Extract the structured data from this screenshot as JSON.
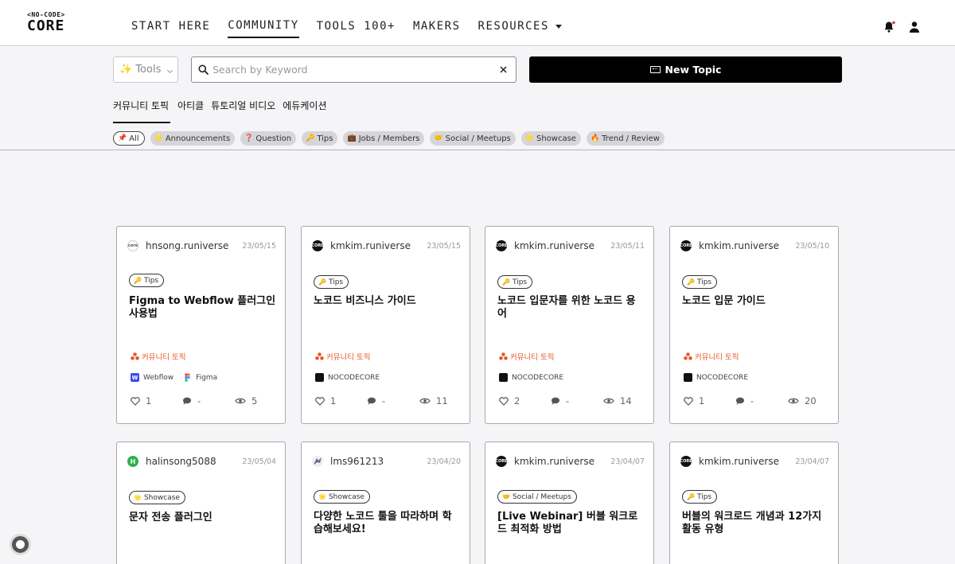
{
  "brand": {
    "top": "<NO-CODE>",
    "main": "CORE"
  },
  "nav": [
    {
      "label": "START HERE"
    },
    {
      "label": "COMMUNITY"
    },
    {
      "label": "TOOLS 100+"
    },
    {
      "label": "MAKERS"
    },
    {
      "label": "RESOURCES"
    }
  ],
  "toolbar": {
    "tools_select": "✨ Tools",
    "search_placeholder": "Search by Keyword",
    "new_topic": "New Topic"
  },
  "tabs": [
    "커뮤니티 토픽",
    "아티클",
    "튜토리얼 비디오",
    "에듀케이션"
  ],
  "chips": [
    {
      "emoji": "📌",
      "label": "All"
    },
    {
      "emoji": "🌟",
      "label": "Announcements"
    },
    {
      "emoji": "❓",
      "label": "Question"
    },
    {
      "emoji": "🔑",
      "label": "Tips"
    },
    {
      "emoji": "💼",
      "label": "Jobs / Members"
    },
    {
      "emoji": "🤝",
      "label": "Social / Meetups"
    },
    {
      "emoji": "🌟",
      "label": "Showcase"
    },
    {
      "emoji": "🔥",
      "label": "Trend / Review"
    }
  ],
  "cards": [
    {
      "author": "hnsong.runiverse",
      "date": "23/05/15",
      "badge": "Tips",
      "badge_emoji": "🔑",
      "title": "Figma to Webflow 플러그인 사용법",
      "category": "커뮤니티 토픽",
      "tools": [
        "Webflow",
        "Figma"
      ],
      "likes": "1",
      "comments": "-",
      "views": "5"
    },
    {
      "author": "kmkim.runiverse",
      "date": "23/05/15",
      "badge": "Tips",
      "badge_emoji": "🔑",
      "title": "노코드 비즈니스 가이드",
      "category": "커뮤니티 토픽",
      "tools": [
        "NOCODECORE"
      ],
      "likes": "1",
      "comments": "-",
      "views": "11"
    },
    {
      "author": "kmkim.runiverse",
      "date": "23/05/11",
      "badge": "Tips",
      "badge_emoji": "🔑",
      "title": "노코드 입문자를 위한 노코드 용어",
      "category": "커뮤니티 토픽",
      "tools": [
        "NOCODECORE"
      ],
      "likes": "2",
      "comments": "-",
      "views": "14"
    },
    {
      "author": "kmkim.runiverse",
      "date": "23/05/10",
      "badge": "Tips",
      "badge_emoji": "🔑",
      "title": "노코드 입문 가이드",
      "category": "커뮤니티 토픽",
      "tools": [
        "NOCODECORE"
      ],
      "likes": "1",
      "comments": "-",
      "views": "20"
    },
    {
      "author": "halinsong5088",
      "date": "23/05/04",
      "badge": "Showcase",
      "badge_emoji": "🌟",
      "title": "문자 전송 플러그인"
    },
    {
      "author": "lms961213",
      "date": "23/04/20",
      "badge": "Showcase",
      "badge_emoji": "🌟",
      "title": "다양한 노코드 툴을 따라하며 학습해보세요!"
    },
    {
      "author": "kmkim.runiverse",
      "date": "23/04/07",
      "badge": "Social / Meetups",
      "badge_emoji": "🤝",
      "title": "[Live Webinar] 버블 워크로드 최적화 방법"
    },
    {
      "author": "kmkim.runiverse",
      "date": "23/04/07",
      "badge": "Tips",
      "badge_emoji": "🔑",
      "title": "버블의 워크로드 개념과 12가지 활동 유형"
    }
  ]
}
